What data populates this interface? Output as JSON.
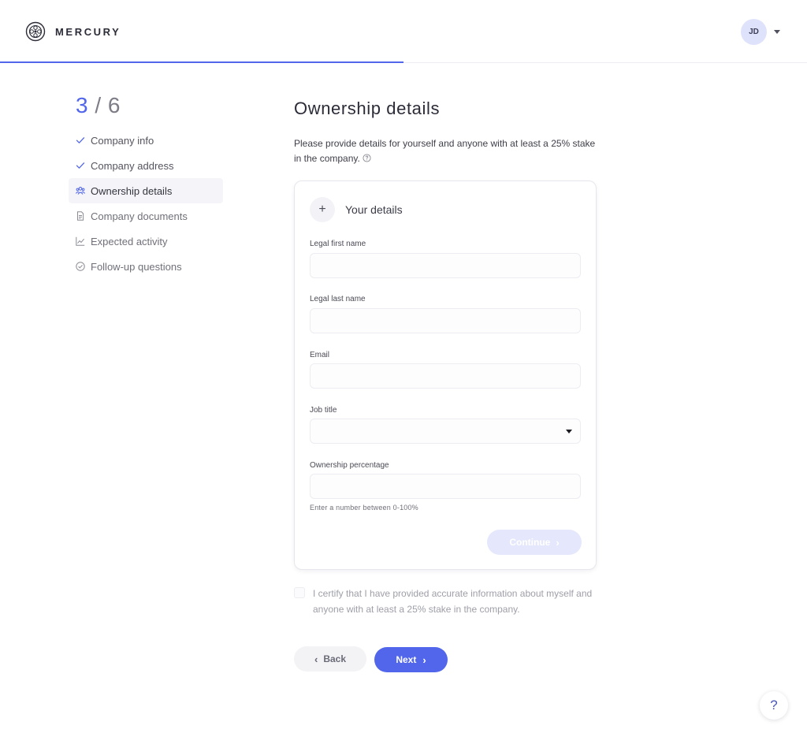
{
  "header": {
    "brand": "MERCURY",
    "logo_icon": "mercury-logo-icon",
    "avatar_initials": "JD",
    "progress": 0.5,
    "accent_color": "#5266eb"
  },
  "sidebar": {
    "step_current": "3",
    "step_separator": "/",
    "step_total": "6",
    "steps": [
      {
        "label": "Company info",
        "icon": "check-icon",
        "state": "done"
      },
      {
        "label": "Company address",
        "icon": "check-icon",
        "state": "done"
      },
      {
        "label": "Ownership details",
        "icon": "people-icon",
        "state": "active"
      },
      {
        "label": "Company documents",
        "icon": "document-icon",
        "state": "pending"
      },
      {
        "label": "Expected activity",
        "icon": "chart-icon",
        "state": "pending"
      },
      {
        "label": "Follow-up questions",
        "icon": "check-circle-icon",
        "state": "pending"
      }
    ]
  },
  "main": {
    "title": "Ownership details",
    "intro": "Please provide details for yourself and anyone with at least a 25% stake in the company.",
    "card": {
      "plus_symbol": "+",
      "title": "Your details",
      "fields": {
        "first_name": {
          "label": "Legal first name",
          "value": ""
        },
        "last_name": {
          "label": "Legal last name",
          "value": ""
        },
        "email": {
          "label": "Email",
          "value": ""
        },
        "job_title": {
          "label": "Job title",
          "value": ""
        },
        "ownership": {
          "label": "Ownership percentage",
          "value": ""
        }
      },
      "hint": "Enter a number between 0-100%",
      "continue_label": "Continue",
      "continue_chevron": "›"
    },
    "certify_text": "I certify that I have provided accurate information about myself and anyone with at least a 25% stake in the company.",
    "back_chevron": "‹",
    "back_label": "Back",
    "next_label": "Next",
    "next_chevron": "›",
    "help_label": "?"
  }
}
